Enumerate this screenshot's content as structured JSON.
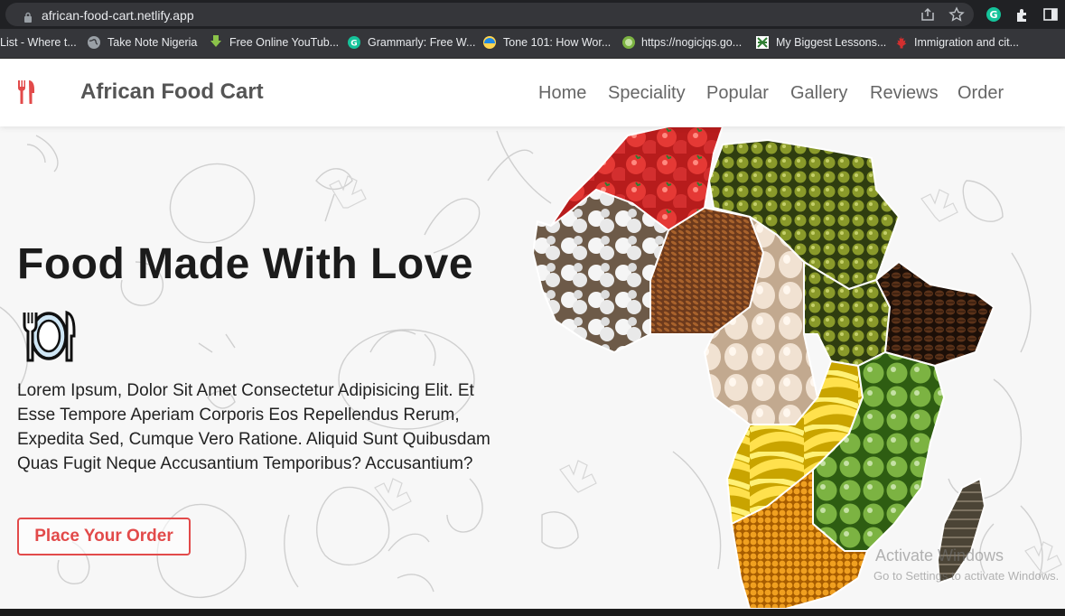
{
  "browser": {
    "url": "african-food-cart.netlify.app",
    "bookmarks": [
      {
        "label": "List - Where t..."
      },
      {
        "label": "Take Note Nigeria"
      },
      {
        "label": "Free Online YouTub..."
      },
      {
        "label": "Grammarly: Free W..."
      },
      {
        "label": "Tone 101: How Wor..."
      },
      {
        "label": "https://nogicjqs.go..."
      },
      {
        "label": "My Biggest Lessons..."
      },
      {
        "label": "Immigration and cit..."
      }
    ]
  },
  "header": {
    "brand": "African Food Cart",
    "nav": [
      "Home",
      "Speciality",
      "Popular",
      "Gallery",
      "Reviews",
      "Order"
    ],
    "accent_color": "#e24a4a"
  },
  "hero": {
    "title": "Food Made With Love",
    "description": "Lorem Ipsum, Dolor Sit Amet Consectetur Adipisicing Elit. Et Esse Tempore Aperiam Corporis Eos Repellendus Rerum, Expedita Sed, Cumque Vero Ratione. Aliquid Sunt Quibusdam Quas Fugit Neque Accusantium Temporibus? Accusantium?",
    "cta": "Place Your Order"
  },
  "watermark": {
    "line1": "Activate Windows",
    "line2": "Go to Settings to activate Windows."
  }
}
